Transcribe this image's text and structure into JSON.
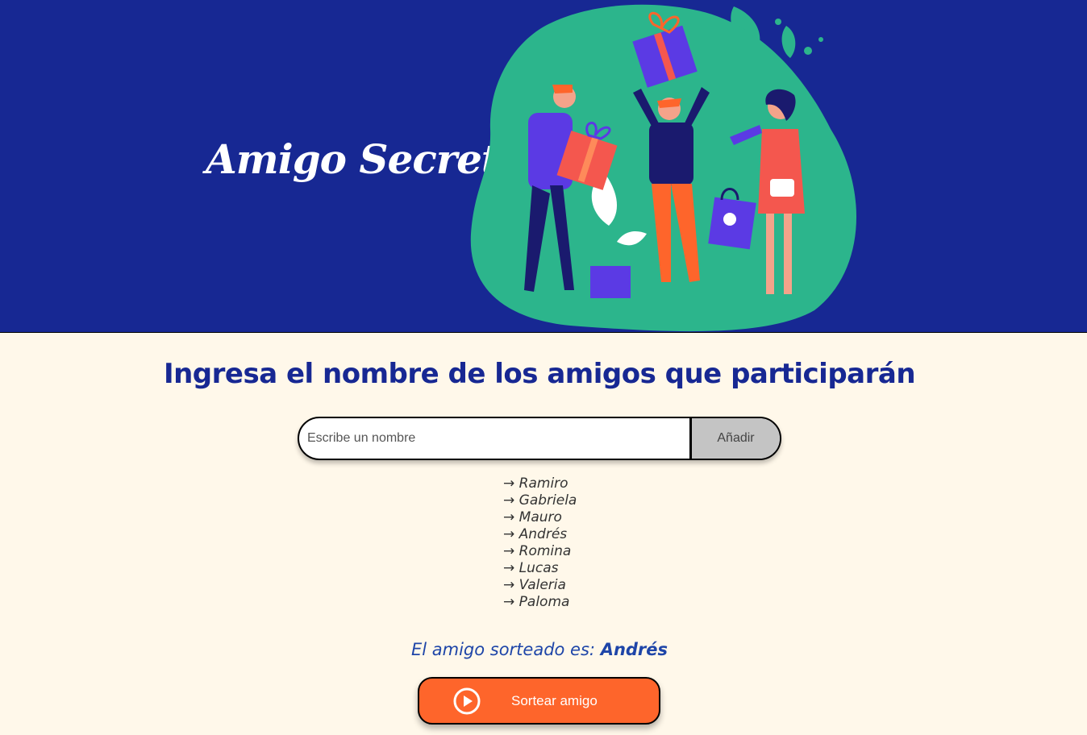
{
  "header": {
    "title": "Amigo Secreto",
    "illustration": "friends-exchanging-gifts-illustration"
  },
  "main": {
    "heading": "Ingresa el nombre de los amigos que participarán",
    "input": {
      "placeholder": "Escribe un nombre",
      "value": ""
    },
    "add_label": "Añadir",
    "list_arrow": "→",
    "friends": [
      "Ramiro",
      "Gabriela",
      "Mauro",
      "Andrés",
      "Romina",
      "Lucas",
      "Valeria",
      "Paloma"
    ],
    "result_prefix": "El amigo sorteado es:",
    "result_name": "Andrés",
    "draw_label": "Sortear amigo",
    "draw_icon": "play-circle-icon"
  },
  "colors": {
    "header_bg": "#172893",
    "page_bg": "#fff8ea",
    "heading": "#172893",
    "accent": "#fe652b",
    "add_button": "#c4c4c4",
    "blob": "#2cb58c"
  }
}
